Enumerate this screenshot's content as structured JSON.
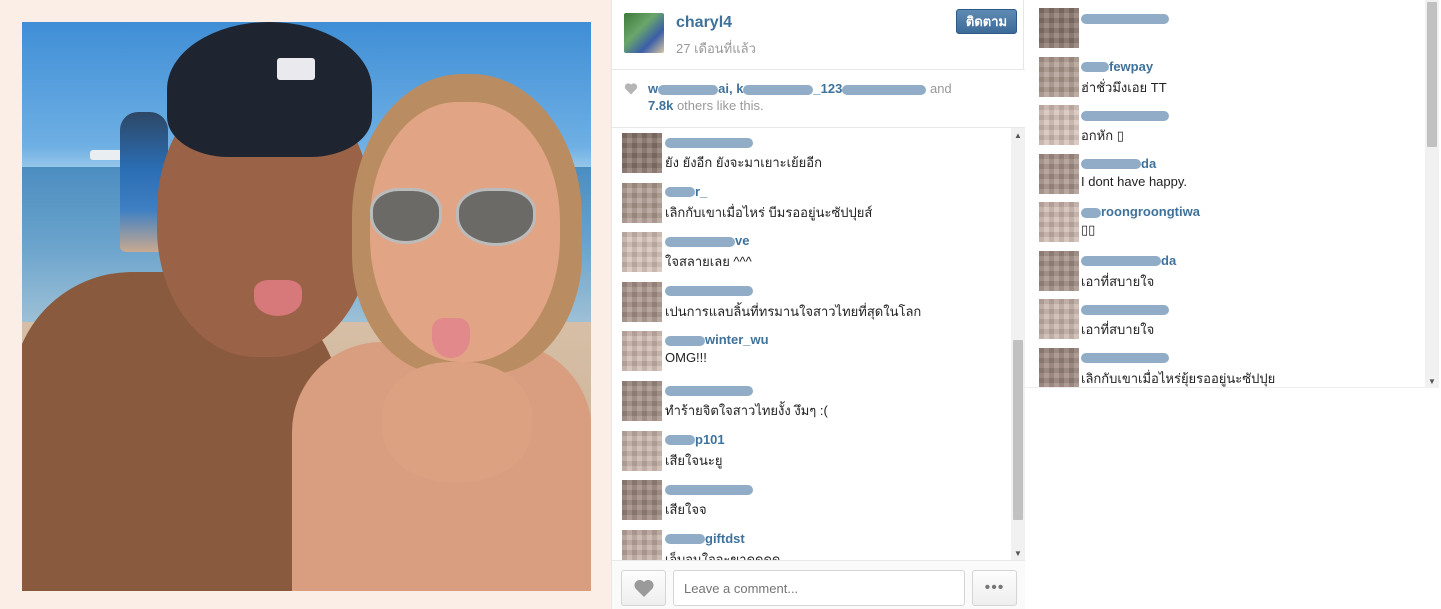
{
  "post": {
    "username": "charyl4",
    "time_ago": "27 เดือนที่แล้ว",
    "follow_label": "ติดตาม",
    "likes": {
      "likers_line": [
        {
          "visible": "w",
          "hidden_width": 60
        },
        {
          "visible": "ai, k",
          "hidden_width": 70
        },
        {
          "visible": "_123",
          "hidden_width": 84
        }
      ],
      "and_label": "and",
      "count": "7.8k",
      "suffix": "others like this."
    },
    "comment_placeholder": "Leave a comment...",
    "more_label": "•••"
  },
  "comments": [
    {
      "user": "",
      "text": "ยัง ยังอีก ยังจะมาเยาะเย้ยอีก"
    },
    {
      "user": "r_",
      "text": "เลิกกับเขาเมื่อไหร่ บีมรออยู่นะซัปปุยส์"
    },
    {
      "user": "ve",
      "text": "ใจสลายเลย ^^^"
    },
    {
      "user": "",
      "text": "เปนการแลบลิ้นที่ทรมานใจสาวไทยที่สุดในโลก"
    },
    {
      "user": "winter_wu",
      "text": "OMG!!!"
    },
    {
      "user": "",
      "text": "ทำร้ายจิตใจสาวไทยงั้ง งึมๆ :("
    },
    {
      "user": "p101",
      "text": "เสียใจนะยู"
    },
    {
      "user": "",
      "text": "เสียใจจ"
    },
    {
      "user": "giftdst",
      "text": "เจ็บจนใจจะขาดดดด"
    }
  ],
  "right_comments": [
    {
      "user": "",
      "text": ""
    },
    {
      "user": "fewpay",
      "text": "ฮ่าชั่วมึงเอย TT"
    },
    {
      "user": "",
      "text": "อกหัก ▯"
    },
    {
      "user": "da",
      "text": "I dont have happy."
    },
    {
      "user": "roongroongtiwa",
      "text": "▯▯"
    },
    {
      "user": "da",
      "text": "เอาที่สบายใจ"
    },
    {
      "user": "",
      "text": "เอาที่สบายใจ"
    },
    {
      "user": "",
      "text": "เลิกกับเขาเมื่อไหร่ยุ้ยรออยู่นะซัปปุย"
    }
  ],
  "icons": {
    "heart": "heart-icon",
    "scroll_up": "scroll-up-icon",
    "scroll_down": "scroll-down-icon"
  },
  "colors": {
    "link": "#3f729b",
    "follow_button": "#3d6b98",
    "photo_frame": "#fbeee6"
  }
}
